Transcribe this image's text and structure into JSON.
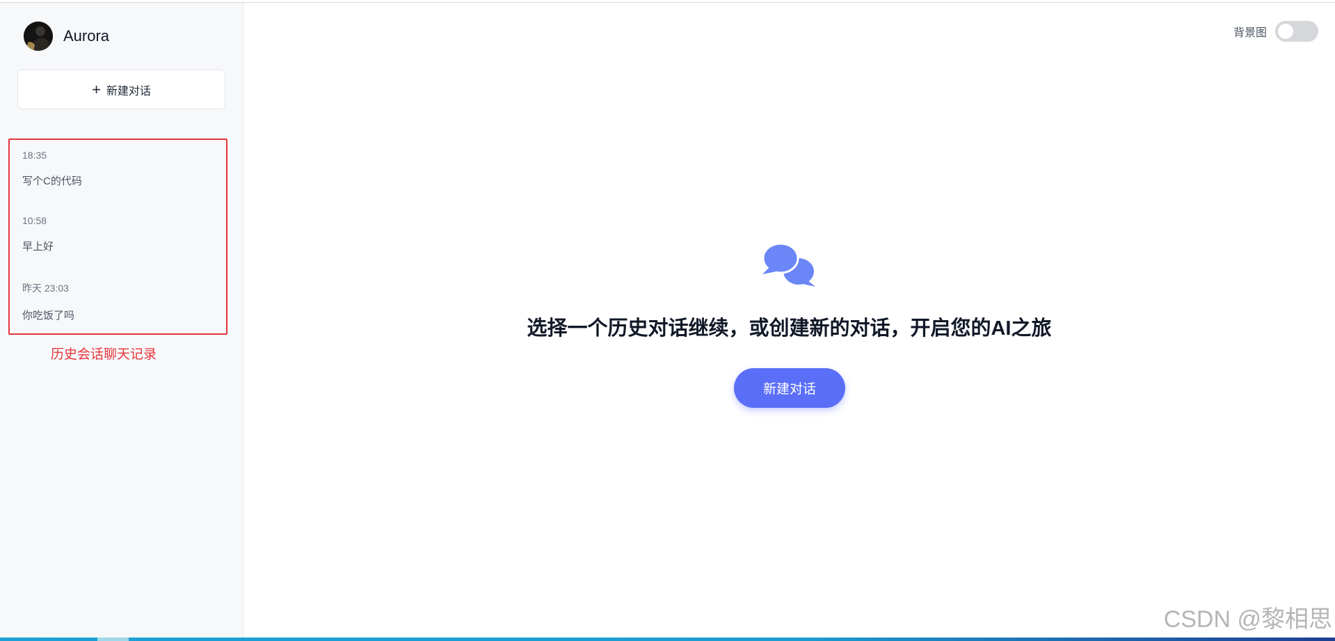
{
  "user": {
    "name": "Aurora",
    "avatar": "avatar-photo"
  },
  "sidebar": {
    "new_chat_label": "新建对话",
    "new_chat_icon": "plus-icon",
    "history": [
      {
        "time": "18:35",
        "title": "写个C的代码"
      },
      {
        "time": "10:58",
        "title": "早上好"
      },
      {
        "time": "昨天 23:03",
        "title": "你吃饭了吗"
      }
    ],
    "annotation": "历史会话聊天记录"
  },
  "header": {
    "toggle_label": "背景图",
    "toggle_on": false
  },
  "main": {
    "icon": "chat-bubbles-icon",
    "headline": "选择一个历史对话继续，或创建新的对话，开启您的AI之旅",
    "new_chat_label": "新建对话"
  },
  "watermark": "CSDN @黎相思",
  "colors": {
    "accent": "#5a6ef7",
    "annotation_red": "#e5353b",
    "sidebar_bg": "#f7f8fa",
    "icon_blue": "#6b86f7"
  }
}
